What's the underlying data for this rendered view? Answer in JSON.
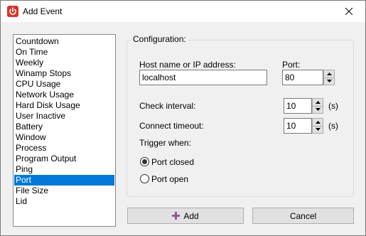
{
  "window": {
    "title": "Add Event",
    "app_icon": "power-icon",
    "close_icon": "close-icon"
  },
  "event_list": {
    "items": [
      "Countdown",
      "On Time",
      "Weekly",
      "Winamp Stops",
      "CPU Usage",
      "Network Usage",
      "Hard Disk Usage",
      "User Inactive",
      "Battery",
      "Window",
      "Process",
      "Program Output",
      "Ping",
      "Port",
      "File Size",
      "Lid"
    ],
    "selected": "Port"
  },
  "configuration": {
    "legend": "Configuration:",
    "host_label": "Host name or IP address:",
    "host_value": "localhost",
    "port_label": "Port:",
    "port_value": "80",
    "check_interval_label": "Check interval:",
    "check_interval_value": "10",
    "check_interval_unit": "(s)",
    "connect_timeout_label": "Connect timeout:",
    "connect_timeout_value": "10",
    "connect_timeout_unit": "(s)",
    "trigger_label": "Trigger when:",
    "trigger_options": [
      "Port closed",
      "Port open"
    ],
    "trigger_selected": "Port closed"
  },
  "buttons": {
    "add_label": "Add",
    "add_icon": "plus-icon",
    "cancel_label": "Cancel"
  },
  "colors": {
    "selection": "#0078d7",
    "app_icon": "#d9362b",
    "add_icon": "#8b5a8c"
  }
}
